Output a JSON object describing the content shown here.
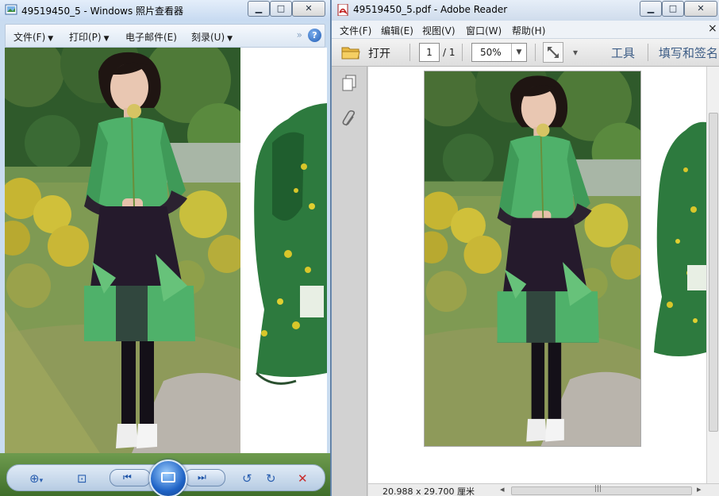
{
  "photo_viewer": {
    "title": "49519450_5 - Windows 照片查看器",
    "window_buttons": {
      "minimize": "▁",
      "maximize": "□",
      "close": "✕"
    },
    "menu": [
      {
        "label": "文件(F)",
        "arrow": "▼"
      },
      {
        "label": "打印(P)",
        "arrow": "▼"
      },
      {
        "label": "电子邮件(E)"
      },
      {
        "label": "刻录(U)",
        "arrow": "▼"
      }
    ],
    "overflow": "»",
    "help": "?",
    "controls": {
      "zoom": "⊕",
      "zoom_arrow": "▾",
      "fit": "⊡",
      "previous": "⏮",
      "next": "⏭",
      "rotate_ccw": "↺",
      "rotate_cw": "↻",
      "delete": "✕"
    }
  },
  "reader": {
    "title": "49519450_5.pdf - Adobe Reader",
    "window_buttons": {
      "minimize": "▁",
      "maximize": "□",
      "close": "✕"
    },
    "doc_close": "×",
    "menu": [
      "文件(F)",
      "编辑(E)",
      "视图(V)",
      "窗口(W)",
      "帮助(H)"
    ],
    "toolbar": {
      "open": "打开",
      "page": "1",
      "page_total": "/ 1",
      "zoom": "50%",
      "zoom_arrow": "▼",
      "more": "▾",
      "tools": "工具",
      "fill_sign": "填写和签名"
    },
    "status": {
      "page_size": "20.988 x 29.700 厘米",
      "scroll_left": "◂",
      "scroll_right": "▸",
      "scroll_grip": "|||"
    }
  },
  "colors": {
    "grass": "#7f9a53",
    "trees": "#3f6a33",
    "path": "#b9b4ac",
    "dress_dark": "#251a2c",
    "dress_green": "#4fb16a",
    "yellow": "#d8c62a",
    "painting_green": "#2d7a3e"
  }
}
